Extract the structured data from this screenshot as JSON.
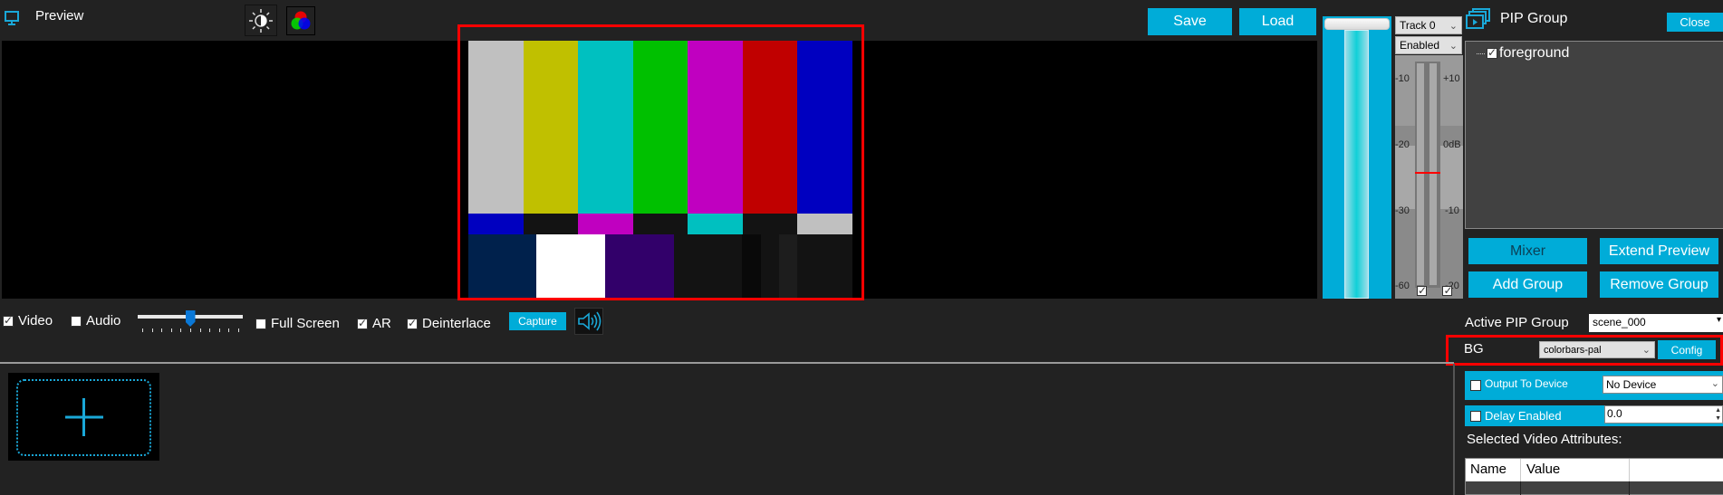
{
  "header": {
    "title": "Preview",
    "brightness_icon": "brightness-contrast-icon",
    "color_icon": "rgb-color-wheel-icon",
    "save_label": "Save",
    "load_label": "Load"
  },
  "preview": {
    "colorbars_top": [
      "#c0c0c0",
      "#c0c000",
      "#00c0c0",
      "#00c000",
      "#c000c0",
      "#c00000",
      "#0000c0"
    ],
    "colorbars_mid": [
      "#0000c0",
      "#131313",
      "#c000c0",
      "#131313",
      "#00c0c0",
      "#131313",
      "#c0c0c0"
    ],
    "colorbars_bottom": [
      "#00214c",
      "#ffffff",
      "#32006a",
      "#131313",
      "#090909",
      "#131313",
      "#1d1d1d",
      "#131313"
    ]
  },
  "audio": {
    "track_select": "Track 0",
    "enabled_select": "Enabled",
    "left_scale": [
      "-10",
      "-20",
      "-30",
      "-60"
    ],
    "right_scale": [
      "+10",
      "0dB",
      "-10",
      "-20"
    ]
  },
  "controls": {
    "video_label": "Video",
    "video_checked": true,
    "audio_label": "Audio",
    "audio_checked": false,
    "volume_slider_value": 0.5,
    "fullscreen_label": "Full Screen",
    "fullscreen_checked": false,
    "ar_label": "AR",
    "ar_checked": true,
    "deinterlace_label": "Deinterlace",
    "deinterlace_checked": true,
    "capture_label": "Capture"
  },
  "pip": {
    "title": "PIP Group",
    "close_label": "Close",
    "tree_items": [
      {
        "label": "foreground",
        "checked": true
      }
    ],
    "mixer_label": "Mixer",
    "extend_preview_label": "Extend Preview",
    "add_group_label": "Add Group",
    "remove_group_label": "Remove Group",
    "active_pip_label": "Active PIP Group",
    "active_pip_value": "scene_000",
    "bg_label": "BG",
    "bg_value": "colorbars-pal",
    "config_label": "Config",
    "output_device_label": "Output To Device",
    "output_device_value": "No Device",
    "delay_label": "Delay Enabled",
    "delay_value": "0.0",
    "attributes_title": "Selected Video Attributes:",
    "attr_columns": [
      "Name",
      "Value"
    ]
  }
}
